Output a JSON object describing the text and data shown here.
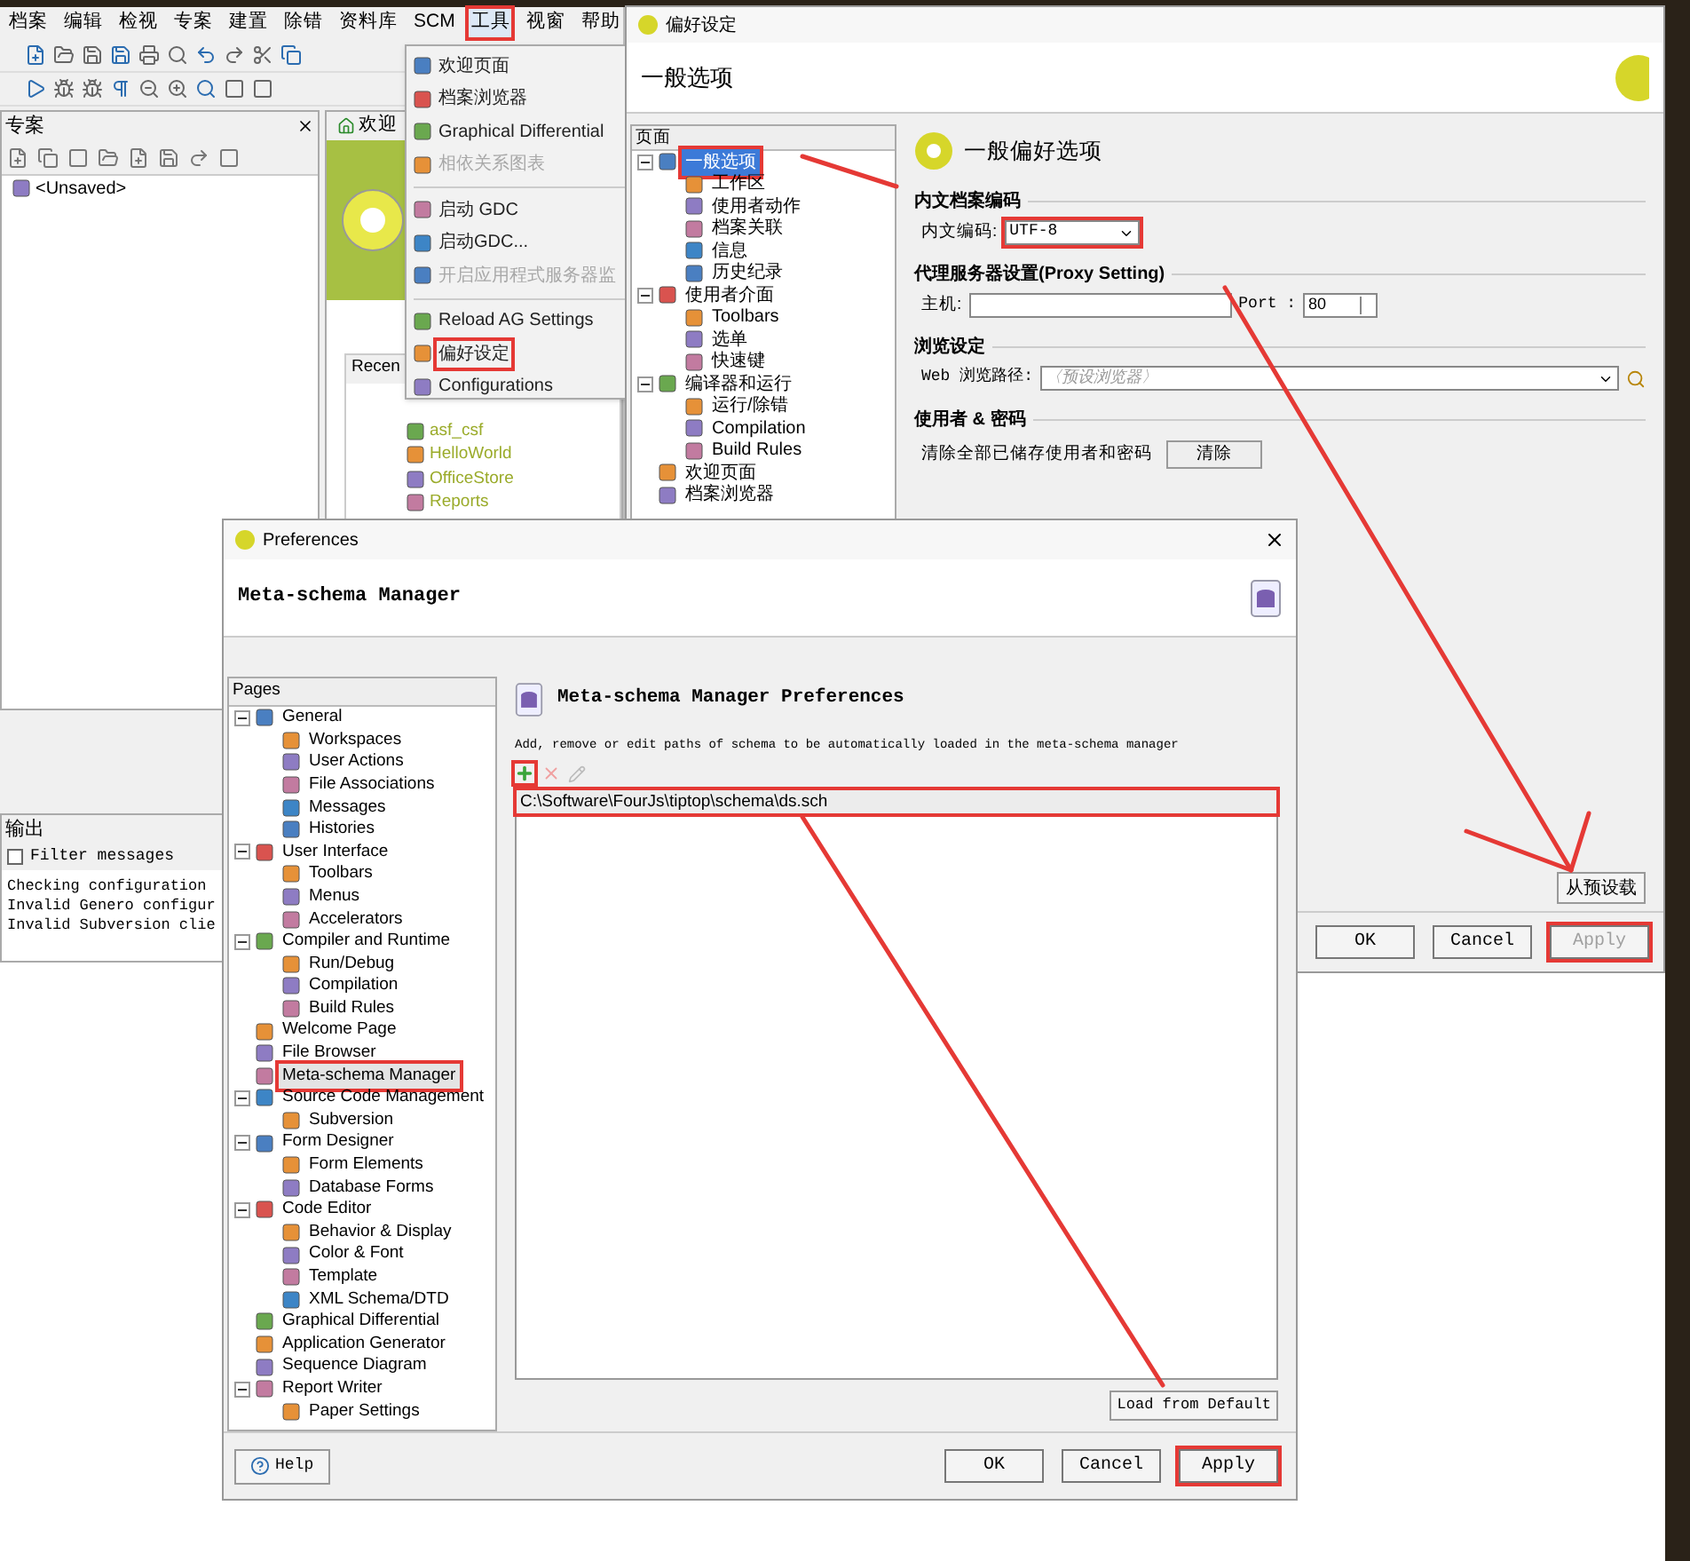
{
  "ide": {
    "menu": [
      {
        "label": "档案",
        "selected": false,
        "annotated": false
      },
      {
        "label": "编辑",
        "selected": false,
        "annotated": false
      },
      {
        "label": "检视",
        "selected": false,
        "annotated": false
      },
      {
        "label": "专案",
        "selected": false,
        "annotated": false
      },
      {
        "label": "建置",
        "selected": false,
        "annotated": false
      },
      {
        "label": "除错",
        "selected": false,
        "annotated": false
      },
      {
        "label": "资料库",
        "selected": false,
        "annotated": false
      },
      {
        "label": "SCM",
        "selected": false,
        "annotated": false
      },
      {
        "label": "工具",
        "selected": true,
        "annotated": true
      },
      {
        "label": "视窗",
        "selected": false,
        "annotated": false
      },
      {
        "label": "帮助",
        "selected": false,
        "annotated": false
      }
    ],
    "project_panel": {
      "title": "专案",
      "items": [
        "<Unsaved>"
      ]
    },
    "welcome_tab": "欢迎",
    "recent": {
      "title": "Recen",
      "items": [
        "asf_csf",
        "HelloWorld",
        "OfficeStore",
        "Reports"
      ]
    },
    "output_panel": {
      "title": "输出",
      "filter": {
        "label": "Filter messages",
        "checked": false
      },
      "lines": [
        "Checking configuration",
        "Invalid Genero configur",
        "Invalid Subversion clie"
      ]
    }
  },
  "tools_menu": [
    {
      "kind": "item",
      "label": "欢迎页面",
      "disabled": false,
      "annotated": false
    },
    {
      "kind": "item",
      "label": "档案浏览器",
      "disabled": false,
      "annotated": false
    },
    {
      "kind": "item",
      "label": "Graphical Differential",
      "disabled": false,
      "annotated": false
    },
    {
      "kind": "item",
      "label": "相依关系图表",
      "disabled": true,
      "annotated": false
    },
    {
      "kind": "separator"
    },
    {
      "kind": "item",
      "label": "启动 GDC",
      "disabled": false,
      "annotated": false
    },
    {
      "kind": "item",
      "label": "启动GDC...",
      "disabled": false,
      "annotated": false
    },
    {
      "kind": "item",
      "label": "开启应用程式服务器监",
      "disabled": true,
      "annotated": false
    },
    {
      "kind": "separator"
    },
    {
      "kind": "item",
      "label": "Reload AG Settings",
      "disabled": false,
      "annotated": false
    },
    {
      "kind": "item",
      "label": "偏好设定",
      "disabled": false,
      "annotated": true
    },
    {
      "kind": "item",
      "label": "Configurations",
      "disabled": false,
      "annotated": false
    }
  ],
  "prefs_cn": {
    "title": "偏好设定",
    "header": "一般选项",
    "pages_header": "页面",
    "pages": [
      {
        "label": "一般选项",
        "selected": true,
        "annotated": true,
        "expanded": true,
        "children": [
          {
            "label": "工作区",
            "selected": false
          },
          {
            "label": "使用者动作",
            "selected": false
          },
          {
            "label": "档案关联",
            "selected": false
          },
          {
            "label": "信息",
            "selected": false
          },
          {
            "label": "历史纪录",
            "selected": false
          }
        ]
      },
      {
        "label": "使用者介面",
        "selected": false,
        "expanded": true,
        "children": [
          {
            "label": "Toolbars",
            "selected": false
          },
          {
            "label": "选单",
            "selected": false
          },
          {
            "label": "快速键",
            "selected": false
          }
        ]
      },
      {
        "label": "编译器和运行",
        "selected": false,
        "expanded": true,
        "children": [
          {
            "label": "运行/除错",
            "selected": false
          },
          {
            "label": "Compilation",
            "selected": false
          },
          {
            "label": "Build Rules",
            "selected": false
          }
        ]
      },
      {
        "label": "欢迎页面",
        "selected": false
      },
      {
        "label": "档案浏览器",
        "selected": false
      }
    ],
    "panel_title": "一般偏好选项",
    "sections": [
      {
        "kind": "encoding",
        "title": "内文档案编码",
        "label": "内文编码:",
        "value": "UTF-8",
        "annotated": true
      },
      {
        "kind": "proxy",
        "title": "代理服务器设置(Proxy Setting)",
        "host_label": "主机:",
        "port_label": "Port :",
        "port": "80"
      },
      {
        "kind": "browser",
        "title": "浏览设定",
        "label": "Web 浏览路径:",
        "placeholder": "〈预设浏览器〉"
      },
      {
        "kind": "password",
        "title": "使用者 & 密码",
        "label": "清除全部已储存使用者和密码",
        "button": "清除"
      }
    ],
    "load_default": "从预设载",
    "buttons": [
      {
        "label": "OK",
        "disabled": false,
        "annotated": false
      },
      {
        "label": "Cancel",
        "disabled": false,
        "annotated": false
      },
      {
        "label": "Apply",
        "disabled": true,
        "annotated": true
      }
    ]
  },
  "prefs_en": {
    "title": "Preferences",
    "header": "Meta-schema Manager",
    "pages_header": "Pages",
    "pages": [
      {
        "label": "General",
        "selected": false,
        "expanded": true,
        "children": [
          {
            "label": "Workspaces",
            "selected": false
          },
          {
            "label": "User Actions",
            "selected": false
          },
          {
            "label": "File Associations",
            "selected": false
          },
          {
            "label": "Messages",
            "selected": false
          },
          {
            "label": "Histories",
            "selected": false
          }
        ]
      },
      {
        "label": "User Interface",
        "selected": false,
        "expanded": true,
        "children": [
          {
            "label": "Toolbars",
            "selected": false
          },
          {
            "label": "Menus",
            "selected": false
          },
          {
            "label": "Accelerators",
            "selected": false
          }
        ]
      },
      {
        "label": "Compiler and Runtime",
        "selected": false,
        "expanded": true,
        "children": [
          {
            "label": "Run/Debug",
            "selected": false
          },
          {
            "label": "Compilation",
            "selected": false
          },
          {
            "label": "Build Rules",
            "selected": false
          }
        ]
      },
      {
        "label": "Welcome Page",
        "selected": false
      },
      {
        "label": "File Browser",
        "selected": false
      },
      {
        "label": "Meta-schema Manager",
        "selected": true,
        "annotated": true
      },
      {
        "label": "Source Code Management",
        "selected": false,
        "expanded": true,
        "children": [
          {
            "label": "Subversion",
            "selected": false
          }
        ]
      },
      {
        "label": "Form Designer",
        "selected": false,
        "expanded": true,
        "children": [
          {
            "label": "Form Elements",
            "selected": false
          },
          {
            "label": "Database Forms",
            "selected": false
          }
        ]
      },
      {
        "label": "Code Editor",
        "selected": false,
        "expanded": true,
        "children": [
          {
            "label": "Behavior & Display",
            "selected": false
          },
          {
            "label": "Color & Font",
            "selected": false
          },
          {
            "label": "Template",
            "selected": false
          },
          {
            "label": "XML Schema/DTD",
            "selected": false
          }
        ]
      },
      {
        "label": "Graphical Differential",
        "selected": false
      },
      {
        "label": "Application Generator",
        "selected": false
      },
      {
        "label": "Sequence Diagram",
        "selected": false
      },
      {
        "label": "Report Writer",
        "selected": false,
        "expanded": true,
        "children": [
          {
            "label": "Paper Settings",
            "selected": false
          }
        ]
      }
    ],
    "panel_title": "Meta-schema Manager Preferences",
    "description": "Add, remove or edit paths of schema to be automatically loaded in the meta-schema manager",
    "add_annotated": true,
    "paths": [
      {
        "label": "C:\\Software\\FourJs\\tiptop\\schema\\ds.sch",
        "annotated": true
      }
    ],
    "load_default": "Load from Default",
    "help": "Help",
    "buttons": [
      {
        "label": "OK",
        "disabled": false,
        "annotated": false
      },
      {
        "label": "Cancel",
        "disabled": false,
        "annotated": false
      },
      {
        "label": "Apply",
        "disabled": false,
        "annotated": true
      }
    ]
  }
}
